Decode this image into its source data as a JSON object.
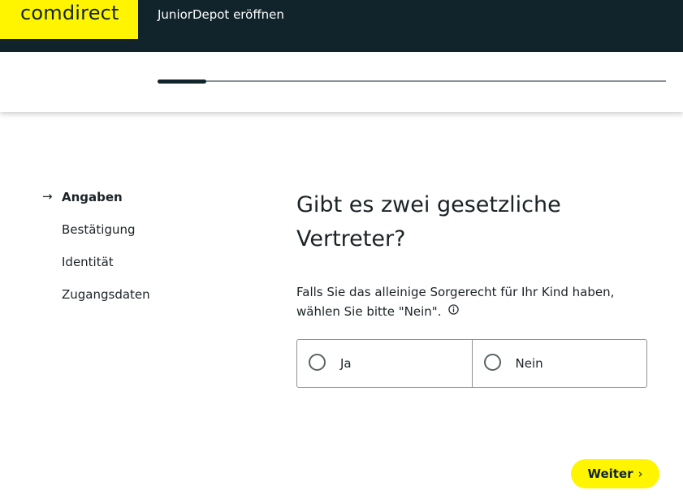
{
  "header": {
    "logo_text": "comdirect",
    "title": "JuniorDepot eröffnen",
    "brand_color": "#fff500",
    "bar_color": "#11242c"
  },
  "progress": {
    "fraction": 0.096
  },
  "steps": [
    {
      "label": "Angaben",
      "active": true,
      "icon": "arrow-right-icon"
    },
    {
      "label": "Bestätigung",
      "active": false
    },
    {
      "label": "Identität",
      "active": false
    },
    {
      "label": "Zugangsdaten",
      "active": false
    }
  ],
  "main": {
    "question": "Gibt es zwei gesetzliche Vertreter?",
    "hint_line1": "Falls Sie das alleinige Sorgerecht für Ihr Kind haben,",
    "hint_line2": "wählen Sie bitte \"Nein\".",
    "info_icon": "info-icon",
    "options": [
      {
        "label": "Ja"
      },
      {
        "label": "Nein"
      }
    ]
  },
  "footer": {
    "next_label": "Weiter",
    "next_icon": "chevron-right-icon"
  }
}
